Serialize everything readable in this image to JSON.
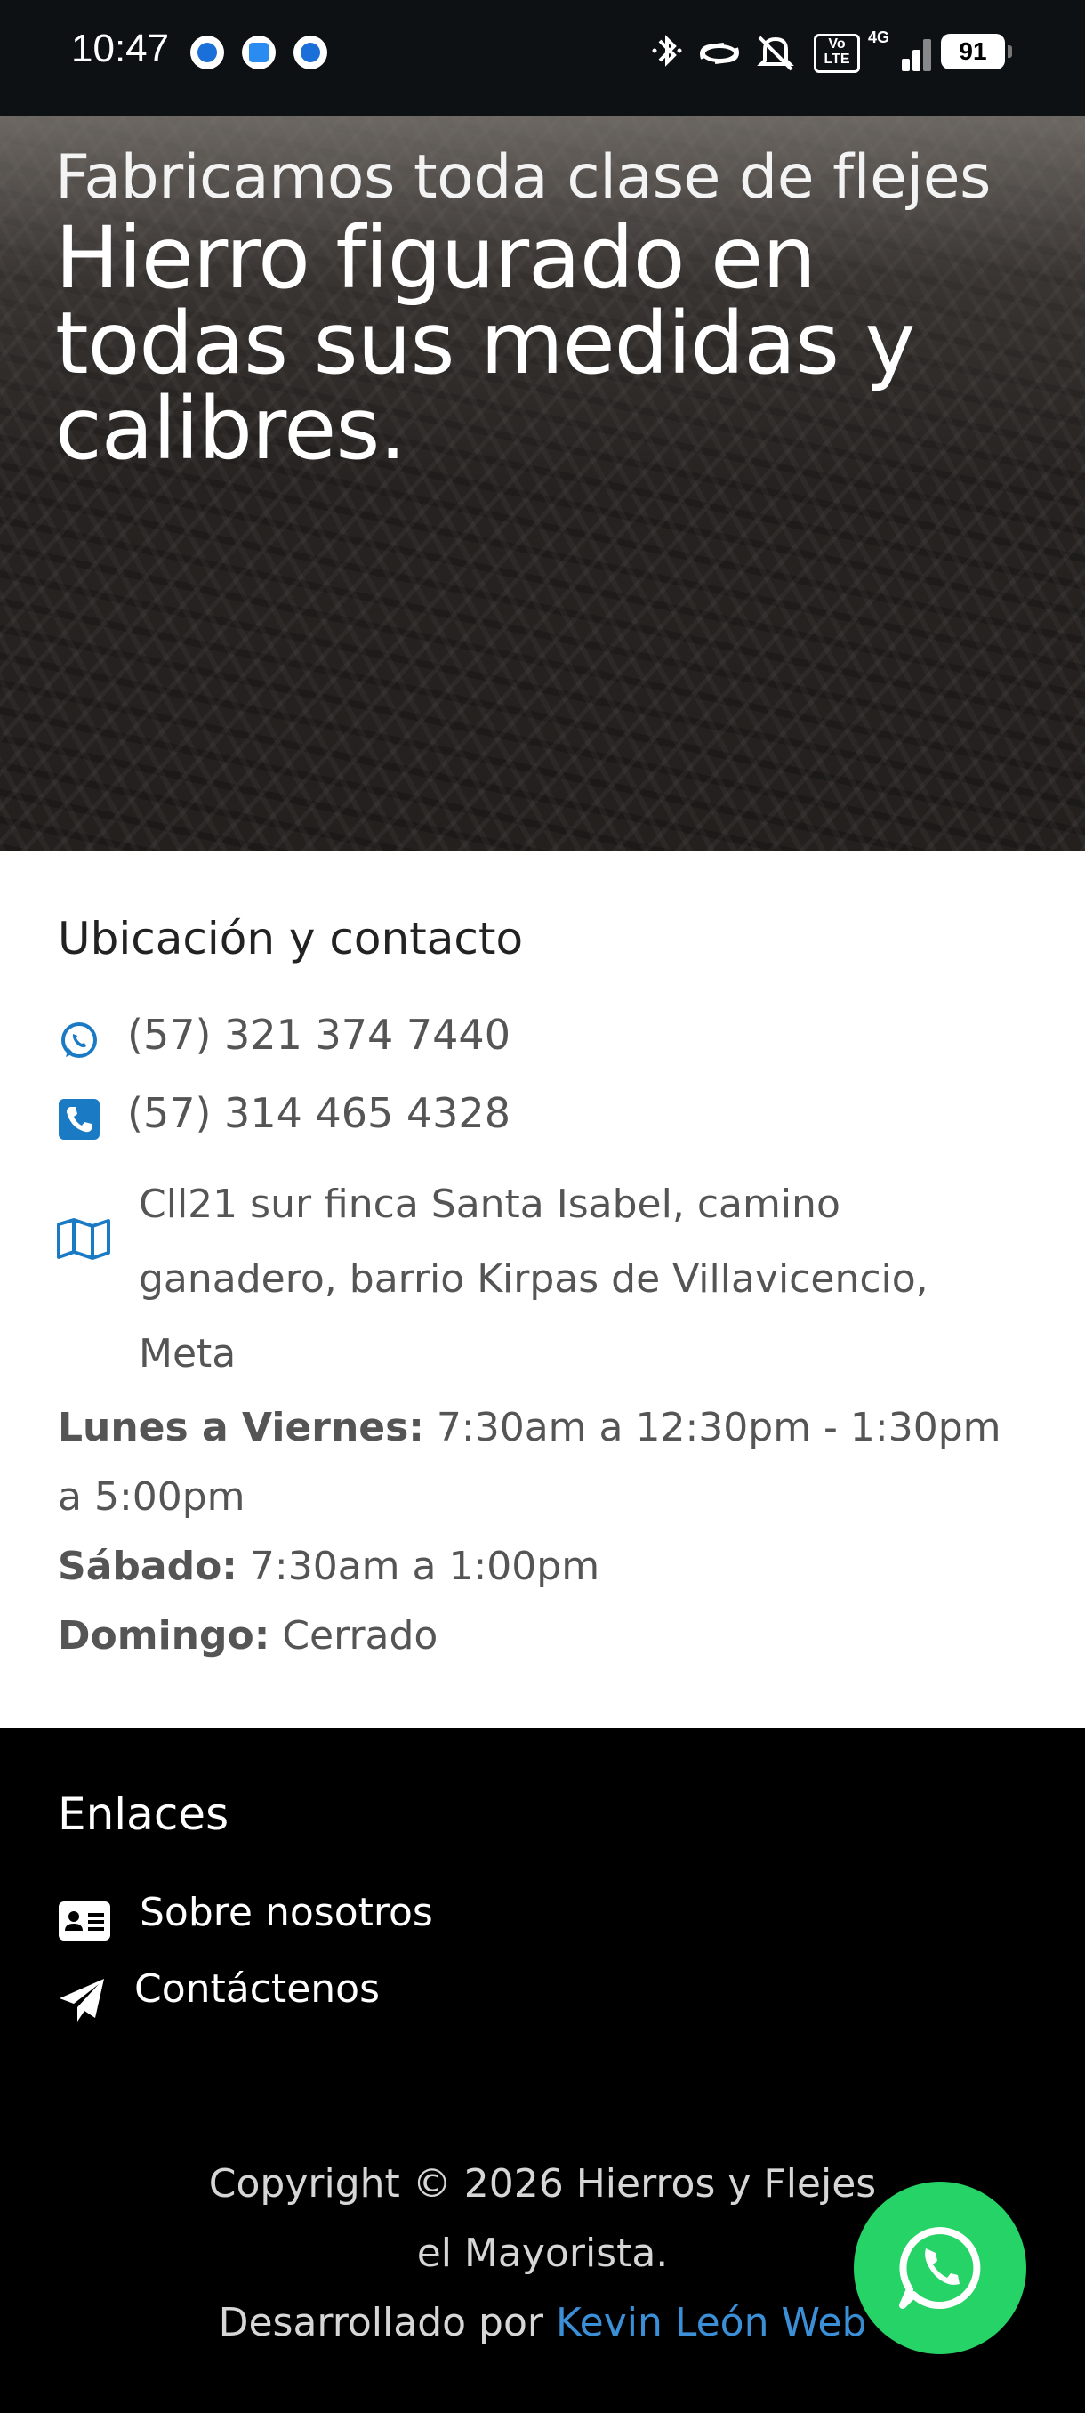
{
  "status_bar": {
    "time": "10:47",
    "network": "4G",
    "volte": "Vo LTE",
    "battery": "91"
  },
  "hero": {
    "subtitle": "Fabricamos toda clase de flejes",
    "title": "Hierro figurado en todas sus medidas y calibres."
  },
  "contact": {
    "title": "Ubicación y contacto",
    "whatsapp": "(57) 321 374 7440",
    "phone": "(57) 314 465 4328",
    "address": "Cll21 sur finca Santa Isabel, camino ganadero, barrio Kirpas de Villavicencio, Meta",
    "hours": {
      "weekdays_label": "Lunes a Viernes:",
      "weekdays_value": "7:30am a 12:30pm - 1:30pm a 5:00pm",
      "saturday_label": "Sábado:",
      "saturday_value": "7:30am a 1:00pm",
      "sunday_label": "Domingo:",
      "sunday_value": "Cerrado"
    }
  },
  "footer": {
    "links_title": "Enlaces",
    "links": [
      "Sobre nosotros",
      "Contáctenos"
    ],
    "copyright_line": "Copyright © 2026 Hierros y Flejes el Mayorista.",
    "developed_by": "Desarrollado por",
    "developer": "Kevin León Web"
  },
  "colors": {
    "accent_blue": "#1a7bc4",
    "link_blue": "#3b8fd6",
    "whatsapp_green": "#25d366"
  }
}
